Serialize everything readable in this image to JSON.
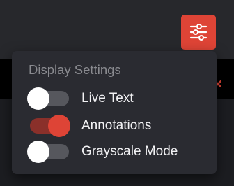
{
  "colors": {
    "accent": "#de4436",
    "toolbar_bg": "#27282c",
    "popover_bg": "#2a2b31",
    "switch_off_track": "#56575d",
    "switch_on_track": "#8a302a"
  },
  "toolbar": {
    "settings_icon": "sliders-icon"
  },
  "display_settings": {
    "title": "Display Settings",
    "toggles": [
      {
        "label": "Live Text",
        "on": false
      },
      {
        "label": "Annotations",
        "on": true
      },
      {
        "label": "Grayscale Mode",
        "on": false
      }
    ]
  },
  "background": {
    "close_icon": "close-icon"
  }
}
